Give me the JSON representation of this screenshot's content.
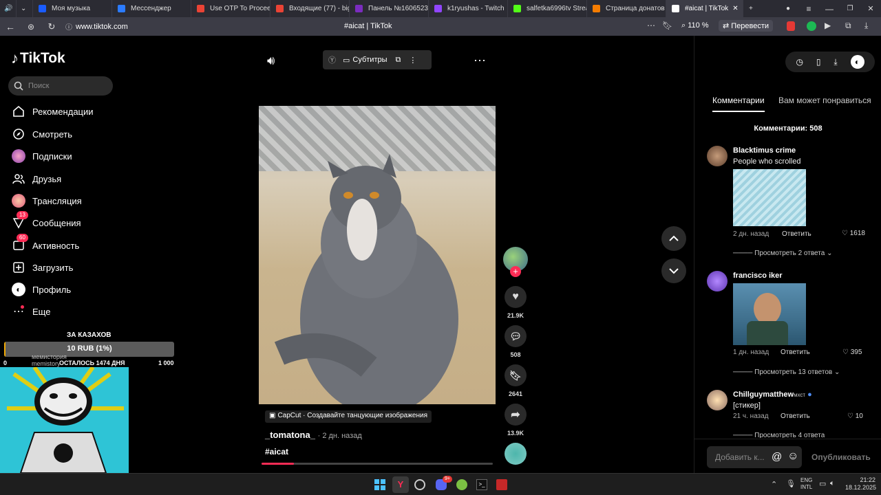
{
  "browser": {
    "tabs": [
      {
        "label": "Моя музыка",
        "color": "#1a5cff"
      },
      {
        "label": "Мессенджер",
        "color": "#2b7bff"
      },
      {
        "label": "Use OTP To Proceed",
        "color": "#ea4335"
      },
      {
        "label": "Входящие (77) - bigp",
        "color": "#ea4335"
      },
      {
        "label": "Панель №1606523 |",
        "color": "#7b2cbf"
      },
      {
        "label": "k1ryushas - Twitch",
        "color": "#9146ff"
      },
      {
        "label": "salfetka6996tv Strean",
        "color": "#53fc18"
      },
      {
        "label": "Страница донатов -",
        "color": "#f57c00"
      },
      {
        "label": "#aicat | TikTok",
        "color": "#ffffff"
      }
    ],
    "url": "www.tiktok.com",
    "page_title": "#aicat | TikTok",
    "zoom": "110 %",
    "translate_label": "Перевести"
  },
  "sidebar": {
    "logo": "TikTok",
    "search_placeholder": "Поиск",
    "items": [
      {
        "label": "Рекомендации",
        "icon": "home-icon"
      },
      {
        "label": "Смотреть",
        "icon": "compass-icon"
      },
      {
        "label": "Подписки",
        "icon": "following-icon"
      },
      {
        "label": "Друзья",
        "icon": "friends-icon"
      },
      {
        "label": "Трансляция",
        "icon": "live-icon"
      },
      {
        "label": "Сообщения",
        "icon": "messages-icon",
        "badge": "13"
      },
      {
        "label": "Активность",
        "icon": "activity-icon",
        "badge": "60"
      },
      {
        "label": "Загрузить",
        "icon": "upload-icon"
      },
      {
        "label": "Профиль",
        "icon": "profile-icon"
      },
      {
        "label": "Еще",
        "icon": "more-icon"
      }
    ]
  },
  "donation_widget": {
    "title": "ЗА КАЗАХОВ",
    "amount": "10 RUB (1%)",
    "progress": 0.01,
    "left_value": "0",
    "remaining": "ОСТАЛОСЬ 1474 ДНЯ",
    "right_value": "1 000",
    "overlay_text": "мемистория\nmemistory"
  },
  "player": {
    "subtitles_label": "Субтитры",
    "caption_source": "CapCut · Создавайте танцующие изображения",
    "author": "_tomatona_",
    "time_ago": "· 2 дн. назад",
    "hashtag": "#aicat",
    "progress": 0.14
  },
  "actions": {
    "likes": "21.9K",
    "comments": "508",
    "saves": "2641",
    "shares": "13.9K"
  },
  "right_panel": {
    "tab_comments": "Комментарии",
    "tab_suggested": "Вам может понравиться",
    "comments_count": "Комментарии: 508",
    "comments": [
      {
        "name": "Blacktimus crime",
        "text": "People who scrolled",
        "time": "2 дн. назад",
        "reply": "Ответить",
        "likes": "1618",
        "more": "Просмотреть 2 ответа"
      },
      {
        "name": "francisco iker",
        "text": "",
        "time": "1 дн. назад",
        "reply": "Ответить",
        "likes": "395",
        "more": "Просмотреть 13 ответов"
      },
      {
        "name": "Chillguymatthew",
        "name_suffix": "мхст",
        "text": "[стикер]",
        "time": "21 ч. назад",
        "reply": "Ответить",
        "likes": "10",
        "more": "Просмотреть 4 ответа"
      }
    ],
    "input_placeholder": "Добавить к...",
    "publish": "Опубликовать"
  },
  "taskbar": {
    "lang": "ENG",
    "lang2": "INTL",
    "time": "21:22",
    "date": "18.12.2025",
    "discord_badge": "9+"
  },
  "colors": {
    "accent": "#fe2c55",
    "chrome_dark": "#2b2b33",
    "widget_teal": "#2ec4d6"
  }
}
